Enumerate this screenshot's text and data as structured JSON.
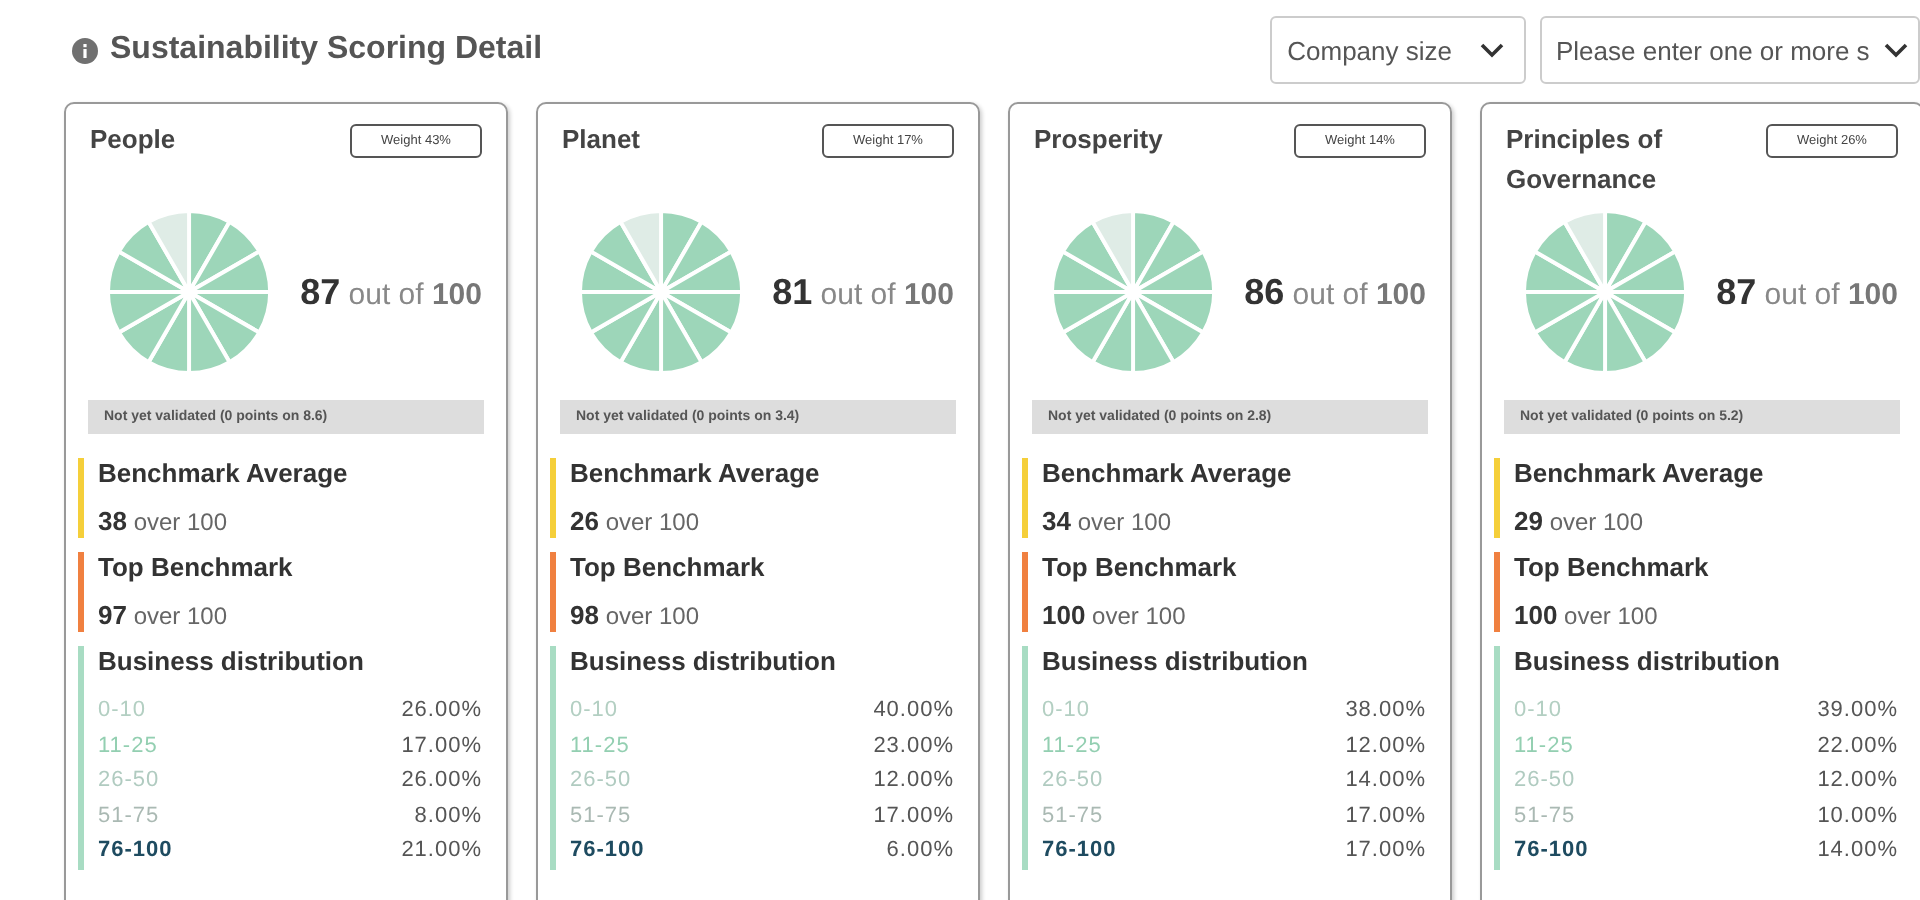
{
  "header": {
    "title": "Sustainability Scoring Detail"
  },
  "filters": [
    {
      "kind": "select",
      "label": "Company size"
    },
    {
      "kind": "input",
      "placeholder": "Please enter one or more s"
    }
  ],
  "cards": [
    {
      "title": "People",
      "weight": "Weight 43%",
      "score": "87",
      "out_of": "out of",
      "max": "100",
      "validation": "Not yet validated (0 points on 8.6)",
      "benchmarks": [
        {
          "label": "Benchmark Average",
          "value": "38",
          "suffix": "over 100",
          "color": "#f5cf3a"
        },
        {
          "label": "Top Benchmark",
          "value": "97",
          "suffix": "over 100",
          "color": "#f08040"
        }
      ],
      "distribution_title": "Business distribution",
      "distribution": [
        {
          "range": "0-10",
          "share": "26.00%",
          "color": "#b3cfc2",
          "bold": false
        },
        {
          "range": "11-25",
          "share": "17.00%",
          "color": "#93cfb1",
          "bold": false
        },
        {
          "range": "26-50",
          "share": "26.00%",
          "color": "#b0cbc0",
          "bold": false
        },
        {
          "range": "51-75",
          "share": "8.00%",
          "color": "#aab9b3",
          "bold": false
        },
        {
          "range": "76-100",
          "share": "21.00%",
          "color": "#1e4b60",
          "bold": true
        }
      ]
    },
    {
      "title": "Planet",
      "weight": "Weight 17%",
      "score": "81",
      "out_of": "out of",
      "max": "100",
      "validation": "Not yet validated (0 points on 3.4)",
      "benchmarks": [
        {
          "label": "Benchmark Average",
          "value": "26",
          "suffix": "over 100",
          "color": "#f5cf3a"
        },
        {
          "label": "Top Benchmark",
          "value": "98",
          "suffix": "over 100",
          "color": "#f08040"
        }
      ],
      "distribution_title": "Business distribution",
      "distribution": [
        {
          "range": "0-10",
          "share": "40.00%",
          "color": "#b3cfc2",
          "bold": false
        },
        {
          "range": "11-25",
          "share": "23.00%",
          "color": "#93cfb1",
          "bold": false
        },
        {
          "range": "26-50",
          "share": "12.00%",
          "color": "#b0cbc0",
          "bold": false
        },
        {
          "range": "51-75",
          "share": "17.00%",
          "color": "#aab9b3",
          "bold": false
        },
        {
          "range": "76-100",
          "share": "6.00%",
          "color": "#1e4b60",
          "bold": true
        }
      ]
    },
    {
      "title": "Prosperity",
      "weight": "Weight 14%",
      "score": "86",
      "out_of": "out of",
      "max": "100",
      "validation": "Not yet validated (0 points on 2.8)",
      "benchmarks": [
        {
          "label": "Benchmark Average",
          "value": "34",
          "suffix": "over 100",
          "color": "#f5cf3a"
        },
        {
          "label": "Top Benchmark",
          "value": "100",
          "suffix": "over 100",
          "color": "#f08040"
        }
      ],
      "distribution_title": "Business distribution",
      "distribution": [
        {
          "range": "0-10",
          "share": "38.00%",
          "color": "#b3cfc2",
          "bold": false
        },
        {
          "range": "11-25",
          "share": "12.00%",
          "color": "#93cfb1",
          "bold": false
        },
        {
          "range": "26-50",
          "share": "14.00%",
          "color": "#b0cbc0",
          "bold": false
        },
        {
          "range": "51-75",
          "share": "17.00%",
          "color": "#aab9b3",
          "bold": false
        },
        {
          "range": "76-100",
          "share": "17.00%",
          "color": "#1e4b60",
          "bold": true
        }
      ]
    },
    {
      "title": "Principles of Governance",
      "weight": "Weight 26%",
      "score": "87",
      "out_of": "out of",
      "max": "100",
      "validation": "Not yet validated (0 points on 5.2)",
      "benchmarks": [
        {
          "label": "Benchmark Average",
          "value": "29",
          "suffix": "over 100",
          "color": "#f5cf3a"
        },
        {
          "label": "Top Benchmark",
          "value": "100",
          "suffix": "over 100",
          "color": "#f08040"
        }
      ],
      "distribution_title": "Business distribution",
      "distribution": [
        {
          "range": "0-10",
          "share": "39.00%",
          "color": "#b3cfc2",
          "bold": false
        },
        {
          "range": "11-25",
          "share": "22.00%",
          "color": "#93cfb1",
          "bold": false
        },
        {
          "range": "26-50",
          "share": "12.00%",
          "color": "#b0cbc0",
          "bold": false
        },
        {
          "range": "51-75",
          "share": "10.00%",
          "color": "#aab9b3",
          "bold": false
        },
        {
          "range": "76-100",
          "share": "14.00%",
          "color": "#1e4b60",
          "bold": true
        }
      ]
    }
  ]
}
